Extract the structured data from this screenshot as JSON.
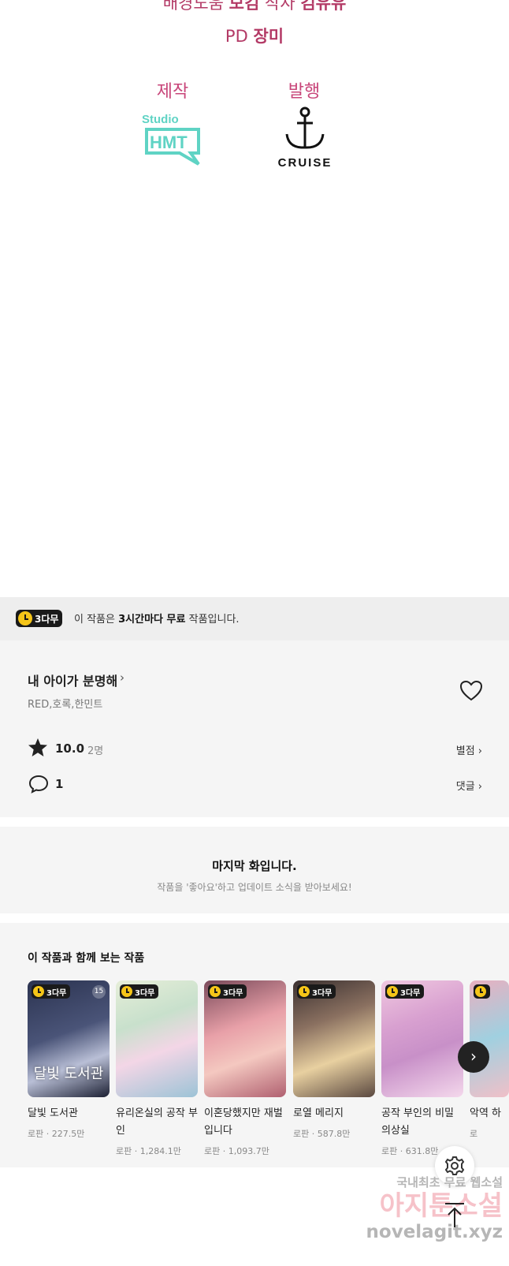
{
  "credits": {
    "line1_prefix": "배경도움",
    "line1_bold1": "보킴",
    "line1_mid": "작자",
    "line1_bold2": "김유유",
    "line2_prefix": "PD",
    "line2_bold": "장미",
    "production_label": "제작",
    "production_logo_line1": "Studio",
    "production_logo_line2": "HMT",
    "publisher_label": "발행",
    "publisher_logo_text": "CRUISE"
  },
  "free_banner": {
    "badge": "3다무",
    "text_pre": "이 작품은",
    "text_bold": "3시간마다 무료",
    "text_post": "작품입니다."
  },
  "work": {
    "title": "내 아이가 분명해",
    "authors": "RED,호록,한민트",
    "rating": "10.0",
    "rating_count": "2명",
    "rate_link": "별점",
    "comment_count": "1",
    "comment_link": "댓글"
  },
  "last_episode": {
    "title": "마지막 화입니다.",
    "subtitle": "작품을 '좋아요'하고 업데이트 소식을 받아보세요!"
  },
  "recommendations": {
    "title": "이 작품과 함께 보는 작품",
    "items": [
      {
        "name": "달빛 도서관",
        "meta": "로판 · 227.5만",
        "badge": "3다무",
        "age": "15",
        "caption": "달빛 도서관"
      },
      {
        "name": "유리온실의 공작 부인",
        "meta": "로판 · 1,284.1만",
        "badge": "3다무"
      },
      {
        "name": "이혼당했지만 재벌입니다",
        "meta": "로판 · 1,093.7만",
        "badge": "3다무"
      },
      {
        "name": "로열 메리지",
        "meta": "로판 · 587.8만",
        "badge": "3다무"
      },
      {
        "name": "공작 부인의 비밀 의상실",
        "meta": "로판 · 631.8만",
        "badge": "3다무"
      },
      {
        "name": "악역 하",
        "meta": "로",
        "badge": ""
      }
    ]
  },
  "watermark": {
    "line1": "국내최초 무료 웹소설",
    "line2": "아지툰소설",
    "line3": "novelagit.xyz"
  },
  "icons": {
    "banner_clock": "clock-icon",
    "heart": "heart-icon",
    "star": "star-icon",
    "comment": "comment-icon",
    "next": "chevron-right-icon",
    "settings": "gear-icon",
    "scroll_top": "arrow-up-icon"
  }
}
